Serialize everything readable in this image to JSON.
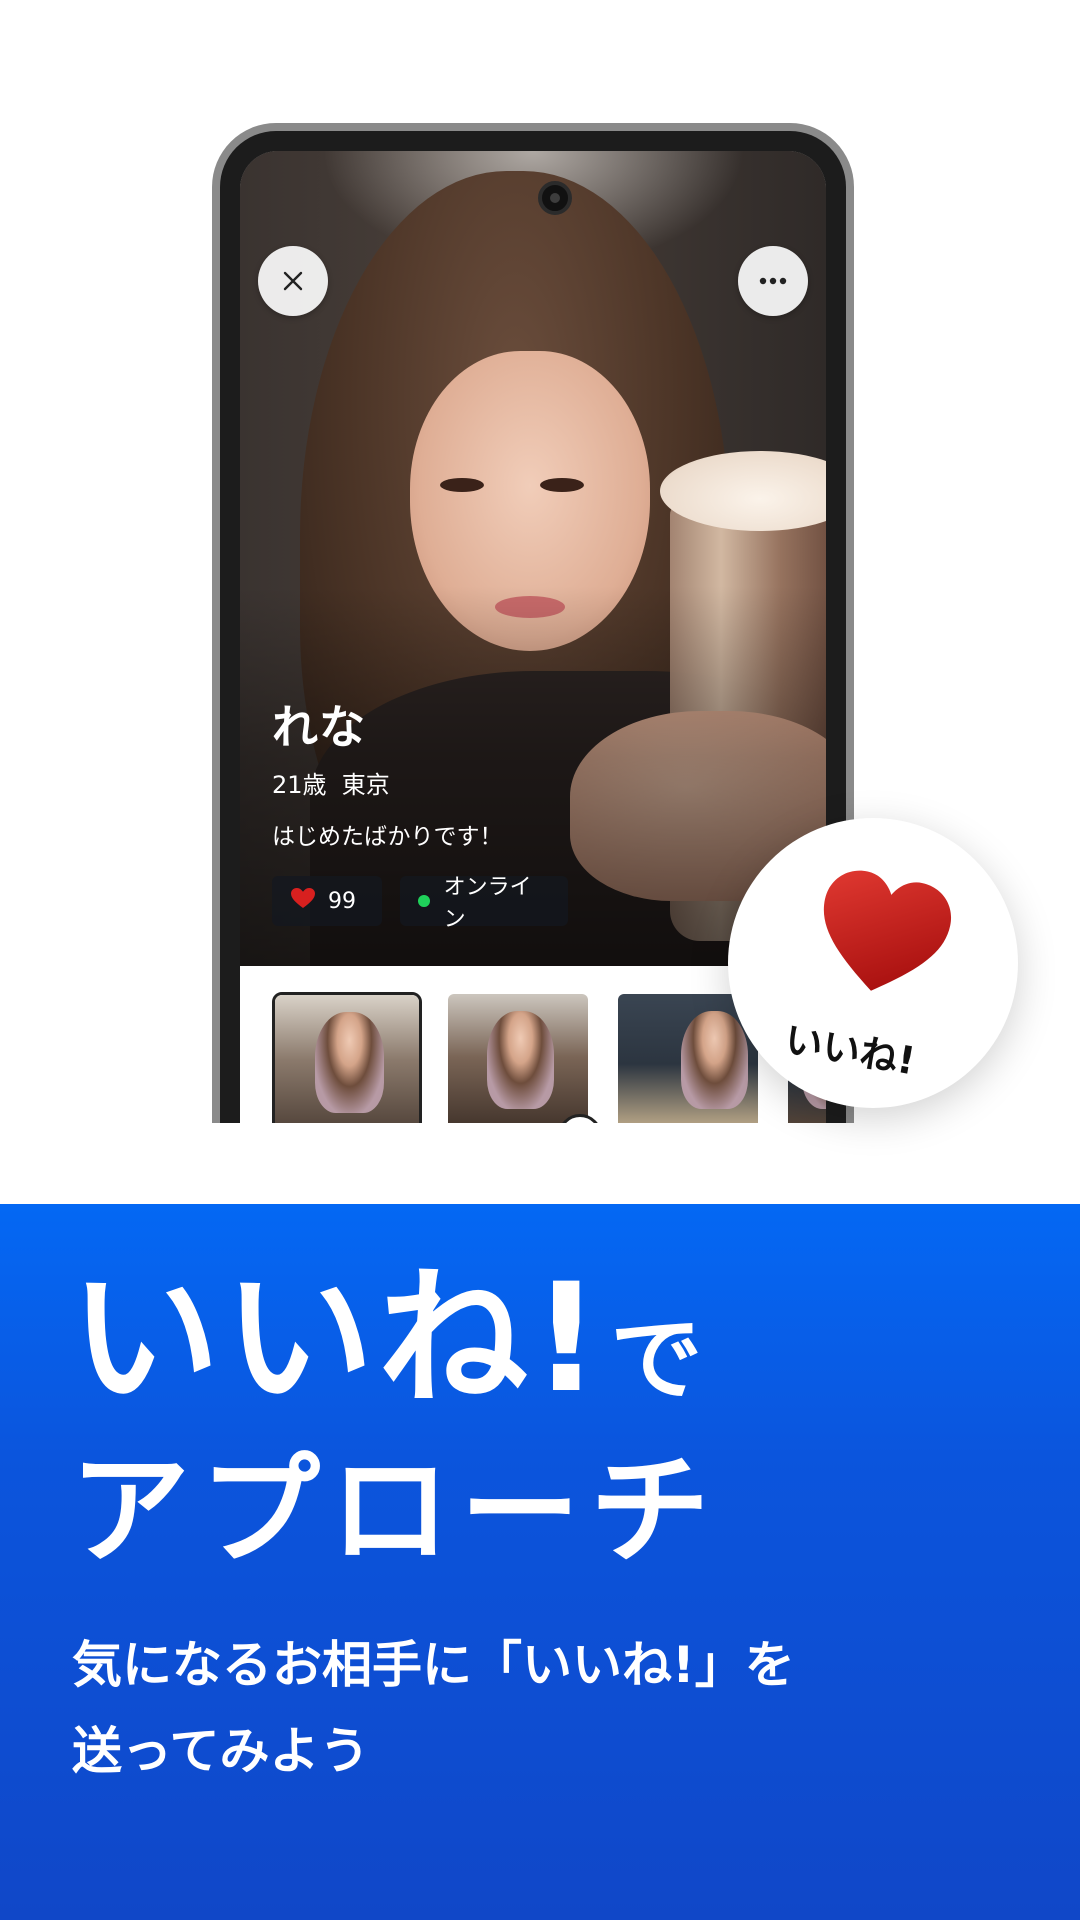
{
  "colors": {
    "panel_top": "#0468f4",
    "panel_bottom": "#1047c8",
    "heart_red": "#d8201f",
    "online_green": "#1fd15a"
  },
  "profile": {
    "name": "れな",
    "age_location": "21歳  東京",
    "bio": "はじめたばかりです！",
    "likes_count": "99",
    "online_status": "オンライン"
  },
  "icons": {
    "close": "close-icon",
    "more": "more-horizontal-icon",
    "heart": "heart-icon",
    "play": "play-icon",
    "online": "online-dot-icon"
  },
  "thumbnails": [
    {
      "selected": true,
      "type": "photo"
    },
    {
      "selected": false,
      "type": "video"
    },
    {
      "selected": false,
      "type": "photo"
    },
    {
      "selected": false,
      "type": "photo"
    }
  ],
  "like_badge": {
    "label": "いいね!"
  },
  "headline": {
    "line1_big": "いいね!",
    "line1_small": "で",
    "line2": "アプローチ"
  },
  "subtext": {
    "line1": "気になるお相手に「いいね!」を",
    "line2": "送ってみよう"
  }
}
